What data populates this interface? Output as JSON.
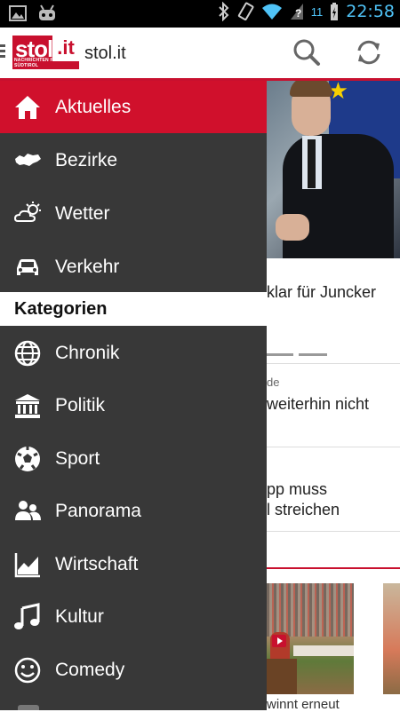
{
  "status_bar": {
    "time": "22:58",
    "signal_label": "11",
    "icons": [
      "picture-icon",
      "android-icon",
      "bluetooth-icon",
      "vibrate-icon",
      "wifi-icon",
      "no-signal-icon",
      "battery-charging-icon"
    ]
  },
  "app_bar": {
    "logo_text": "stol",
    "logo_tld": ".it",
    "logo_tagline": "NACHRICHTEN FÜR SÜDTIROL",
    "title": "stol.it",
    "actions": [
      "search-icon",
      "refresh-icon"
    ]
  },
  "drawer": {
    "main_items": [
      {
        "label": "Aktuelles",
        "icon": "home-icon",
        "active": true
      },
      {
        "label": "Bezirke",
        "icon": "region-map-icon",
        "active": false
      },
      {
        "label": "Wetter",
        "icon": "cloud-sun-icon",
        "active": false
      },
      {
        "label": "Verkehr",
        "icon": "car-icon",
        "active": false
      }
    ],
    "section_title": "Kategorien",
    "category_items": [
      {
        "label": "Chronik",
        "icon": "globe-icon"
      },
      {
        "label": "Politik",
        "icon": "government-building-icon"
      },
      {
        "label": "Sport",
        "icon": "soccer-ball-icon"
      },
      {
        "label": "Panorama",
        "icon": "people-icon"
      },
      {
        "label": "Wirtschaft",
        "icon": "area-chart-icon"
      },
      {
        "label": "Kultur",
        "icon": "music-note-icon"
      },
      {
        "label": "Comedy",
        "icon": "smiley-icon"
      }
    ]
  },
  "background": {
    "headline_1": "klar für Juncker",
    "meta_2": "de",
    "headline_2": "weiterhin nicht",
    "headline_3_line1": "pp muss",
    "headline_3_line2": "l streichen",
    "caption_4": "winnt erneut"
  },
  "colors": {
    "accent": "#d0102c",
    "drawer_bg": "#383838",
    "status_blue": "#4fc3f7"
  }
}
